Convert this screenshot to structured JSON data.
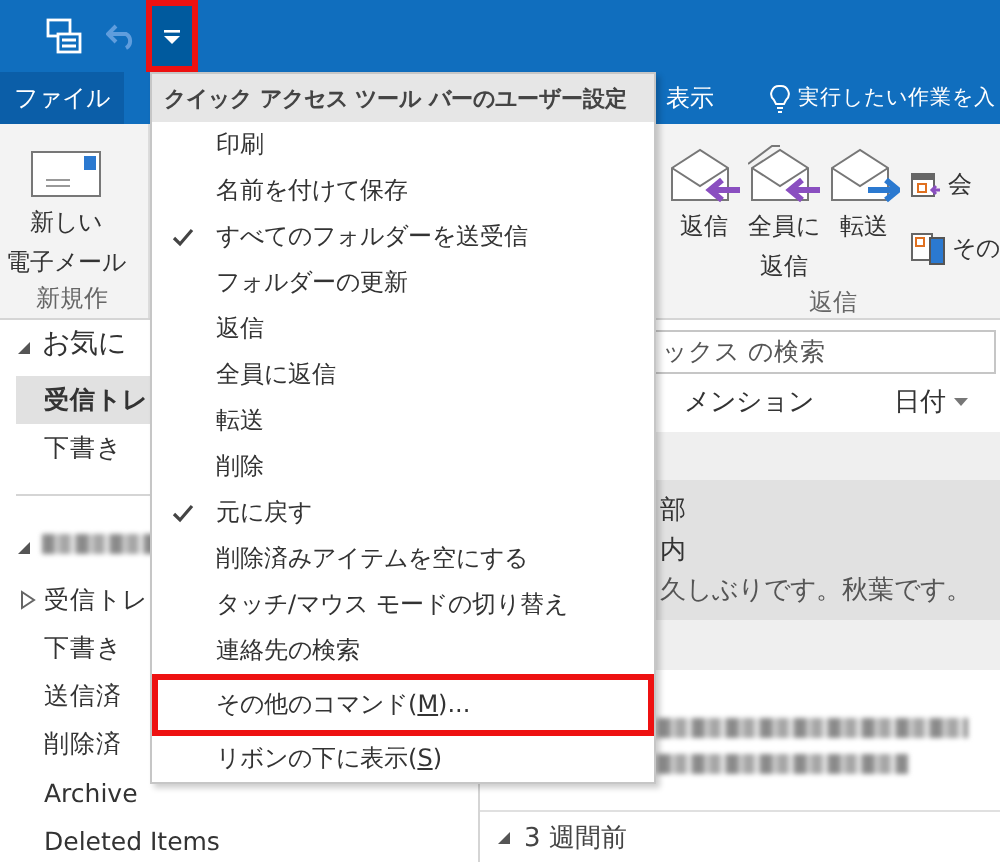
{
  "quick_access": {
    "buttons": [
      {
        "kind": "send-receive",
        "disabled": false,
        "highlighted": false
      },
      {
        "kind": "undo",
        "disabled": true,
        "highlighted": false
      },
      {
        "kind": "customize",
        "disabled": false,
        "highlighted": true
      }
    ]
  },
  "tabs": [
    {
      "label": "ファイル",
      "kind": "file"
    },
    {
      "label": "表示",
      "kind": "tab"
    }
  ],
  "tell_me": {
    "label": "実行したい作業を入"
  },
  "ribbon": {
    "groups": [
      {
        "label": "新規作",
        "buttons": [
          {
            "lines": [
              "新しい",
              "電子メール"
            ],
            "kind": "mail"
          }
        ]
      },
      {
        "label": "返信",
        "buttons": [
          {
            "lines": [
              "返信"
            ],
            "kind": "reply"
          },
          {
            "lines": [
              "全員に",
              "返信"
            ],
            "kind": "reply-all"
          },
          {
            "lines": [
              "転送"
            ],
            "kind": "forward"
          }
        ],
        "small_buttons": [
          {
            "label": "会",
            "kind": "meeting"
          },
          {
            "label": "その",
            "kind": "more"
          }
        ]
      }
    ]
  },
  "folders": {
    "sections": [
      {
        "label": "お気に",
        "redacted": false,
        "expanded": true,
        "items": [
          {
            "label": "受信トレ",
            "selected": true,
            "kind": "plain"
          },
          {
            "label": "下書き",
            "selected": false,
            "kind": "plain"
          }
        ]
      },
      {
        "redacted": true,
        "expanded": true,
        "items": [
          {
            "label": "受信トレ",
            "selected": false,
            "kind": "expandable"
          },
          {
            "label": "下書き",
            "selected": false,
            "kind": "plain"
          },
          {
            "label": "送信済",
            "selected": false,
            "kind": "plain"
          },
          {
            "label": "削除済",
            "selected": false,
            "kind": "plain"
          },
          {
            "label": "Archive",
            "selected": false,
            "kind": "plain"
          },
          {
            "label": "Deleted Items",
            "selected": false,
            "kind": "plain"
          }
        ]
      }
    ]
  },
  "mail_list": {
    "search": {
      "placeholder": "ックス の検索"
    },
    "filter": {
      "label": "メンション"
    },
    "sort": {
      "label": "日付"
    },
    "messages": [
      {
        "sender": "部",
        "subject": "内",
        "preview": "久しぶりです。秋葉です。",
        "selected": true,
        "redacted": false
      },
      {
        "selected": false,
        "redacted": true
      }
    ],
    "groups": [
      {
        "label": "3 週間前",
        "expanded": true
      }
    ]
  },
  "qat_menu": {
    "title": "クイック アクセス ツール バーのユーザー設定",
    "items": [
      {
        "label": "印刷",
        "checked": false,
        "highlighted": false
      },
      {
        "label": "名前を付けて保存",
        "checked": false,
        "highlighted": false
      },
      {
        "label": "すべてのフォルダーを送受信",
        "checked": true,
        "highlighted": false
      },
      {
        "label": "フォルダーの更新",
        "checked": false,
        "highlighted": false
      },
      {
        "label": "返信",
        "checked": false,
        "highlighted": false
      },
      {
        "label": "全員に返信",
        "checked": false,
        "highlighted": false
      },
      {
        "label": "転送",
        "checked": false,
        "highlighted": false
      },
      {
        "label": "削除",
        "checked": false,
        "highlighted": false
      },
      {
        "label": "元に戻す",
        "checked": true,
        "highlighted": false
      },
      {
        "label": "削除済みアイテムを空にする",
        "checked": false,
        "highlighted": false
      },
      {
        "label": "タッチ/マウス モードの切り替え",
        "checked": false,
        "highlighted": false
      },
      {
        "label": "連絡先の検索",
        "checked": false,
        "highlighted": false
      },
      {
        "label": "その他のコマンド(",
        "access_key": "M",
        "label_end": ")...",
        "checked": false,
        "highlighted": true
      },
      {
        "label": "リボンの下に表示(",
        "access_key": "S",
        "label_end": ")",
        "checked": false,
        "highlighted": false
      }
    ]
  }
}
